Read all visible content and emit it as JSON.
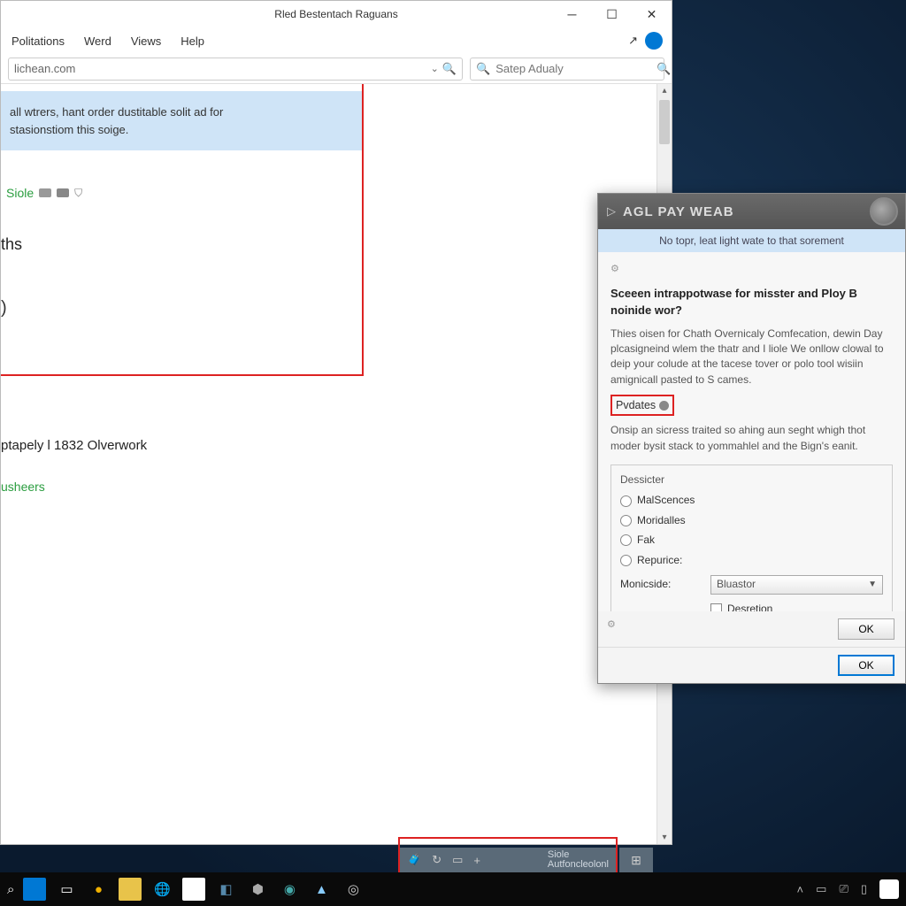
{
  "window": {
    "title": "Rled Bestentach Raguans",
    "menus": [
      "Politations",
      "Werd",
      "Views",
      "Help"
    ]
  },
  "address": {
    "url": "lichean.com"
  },
  "search": {
    "placeholder": "Satep Adualy"
  },
  "notice": {
    "line1": "all wtrers, hant order dustitable solit ad for",
    "line2": "stasionstiom this soige."
  },
  "siole": {
    "label": "Siole"
  },
  "ths_label": "ths",
  "paren": ")",
  "body_line": "ptapely l 1832 Olverwork",
  "green_link": "usheers",
  "dialog": {
    "title": "AGL PAY WEAB",
    "subtitle": "No topr, leat light wate to that sorement",
    "heading": "Sceeen intrappotwase for misster and Ploy B noinide wor?",
    "para1": "Thies oisen for Chath Overnicaly Comfecation, dewin Day plcasigneind wlem the thatr and I liole We onllow clowal to deip your colude at the tacese tover or polo tool wisiin amignicall pasted to S cames.",
    "updates_label": "Pvdates",
    "para2": "Onsip an sicress traited so ahing aun seght whigh thot moder bysit stack to yommahlel and the Bign's eanit.",
    "group_label": "Dessicter",
    "radios": [
      "MalScences",
      "Moridalles",
      "Fak",
      "Repurice:"
    ],
    "select_label": "Monicside:",
    "select_value": "Bluastor",
    "checkbox_label": "Desretion",
    "ok": "OK"
  },
  "tray": {
    "label_top": "Siole",
    "label_bottom": "Autfoncleolonl"
  },
  "colors": {
    "highlight_red": "#d22",
    "accent_blue": "#0078d4",
    "link_green": "#2a9d3f"
  }
}
